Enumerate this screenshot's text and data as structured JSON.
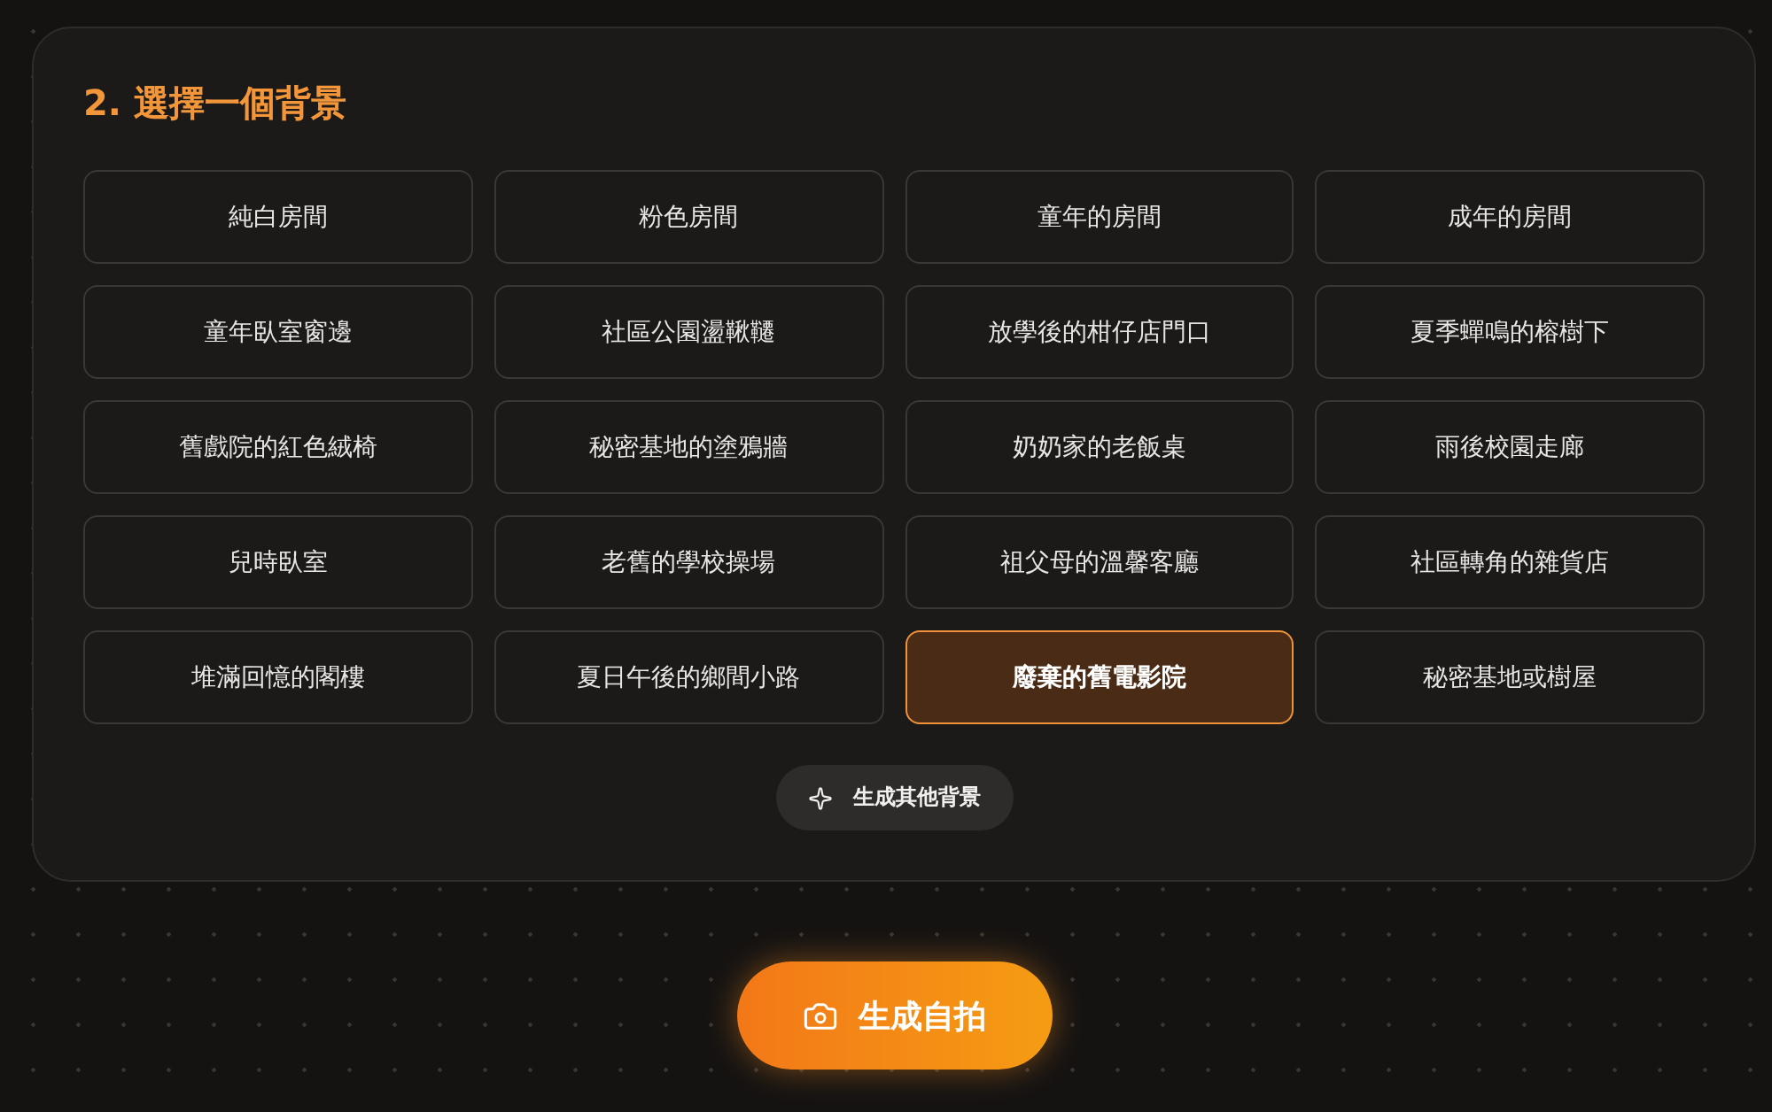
{
  "section": {
    "title": "2. 選擇一個背景",
    "backgrounds": [
      {
        "label": "純白房間",
        "selected": false
      },
      {
        "label": "粉色房間",
        "selected": false
      },
      {
        "label": "童年的房間",
        "selected": false
      },
      {
        "label": "成年的房間",
        "selected": false
      },
      {
        "label": "童年臥室窗邊",
        "selected": false
      },
      {
        "label": "社區公園盪鞦韆",
        "selected": false
      },
      {
        "label": "放學後的柑仔店門口",
        "selected": false
      },
      {
        "label": "夏季蟬鳴的榕樹下",
        "selected": false
      },
      {
        "label": "舊戲院的紅色絨椅",
        "selected": false
      },
      {
        "label": "秘密基地的塗鴉牆",
        "selected": false
      },
      {
        "label": "奶奶家的老飯桌",
        "selected": false
      },
      {
        "label": "雨後校園走廊",
        "selected": false
      },
      {
        "label": "兒時臥室",
        "selected": false
      },
      {
        "label": "老舊的學校操場",
        "selected": false
      },
      {
        "label": "祖父母的溫馨客廳",
        "selected": false
      },
      {
        "label": "社區轉角的雜貨店",
        "selected": false
      },
      {
        "label": "堆滿回憶的閣樓",
        "selected": false
      },
      {
        "label": "夏日午後的鄉間小路",
        "selected": false
      },
      {
        "label": "廢棄的舊電影院",
        "selected": true
      },
      {
        "label": "秘密基地或樹屋",
        "selected": false
      }
    ],
    "more_button": {
      "label": "生成其他背景"
    }
  },
  "generate_button": {
    "label": "生成自拍"
  }
}
